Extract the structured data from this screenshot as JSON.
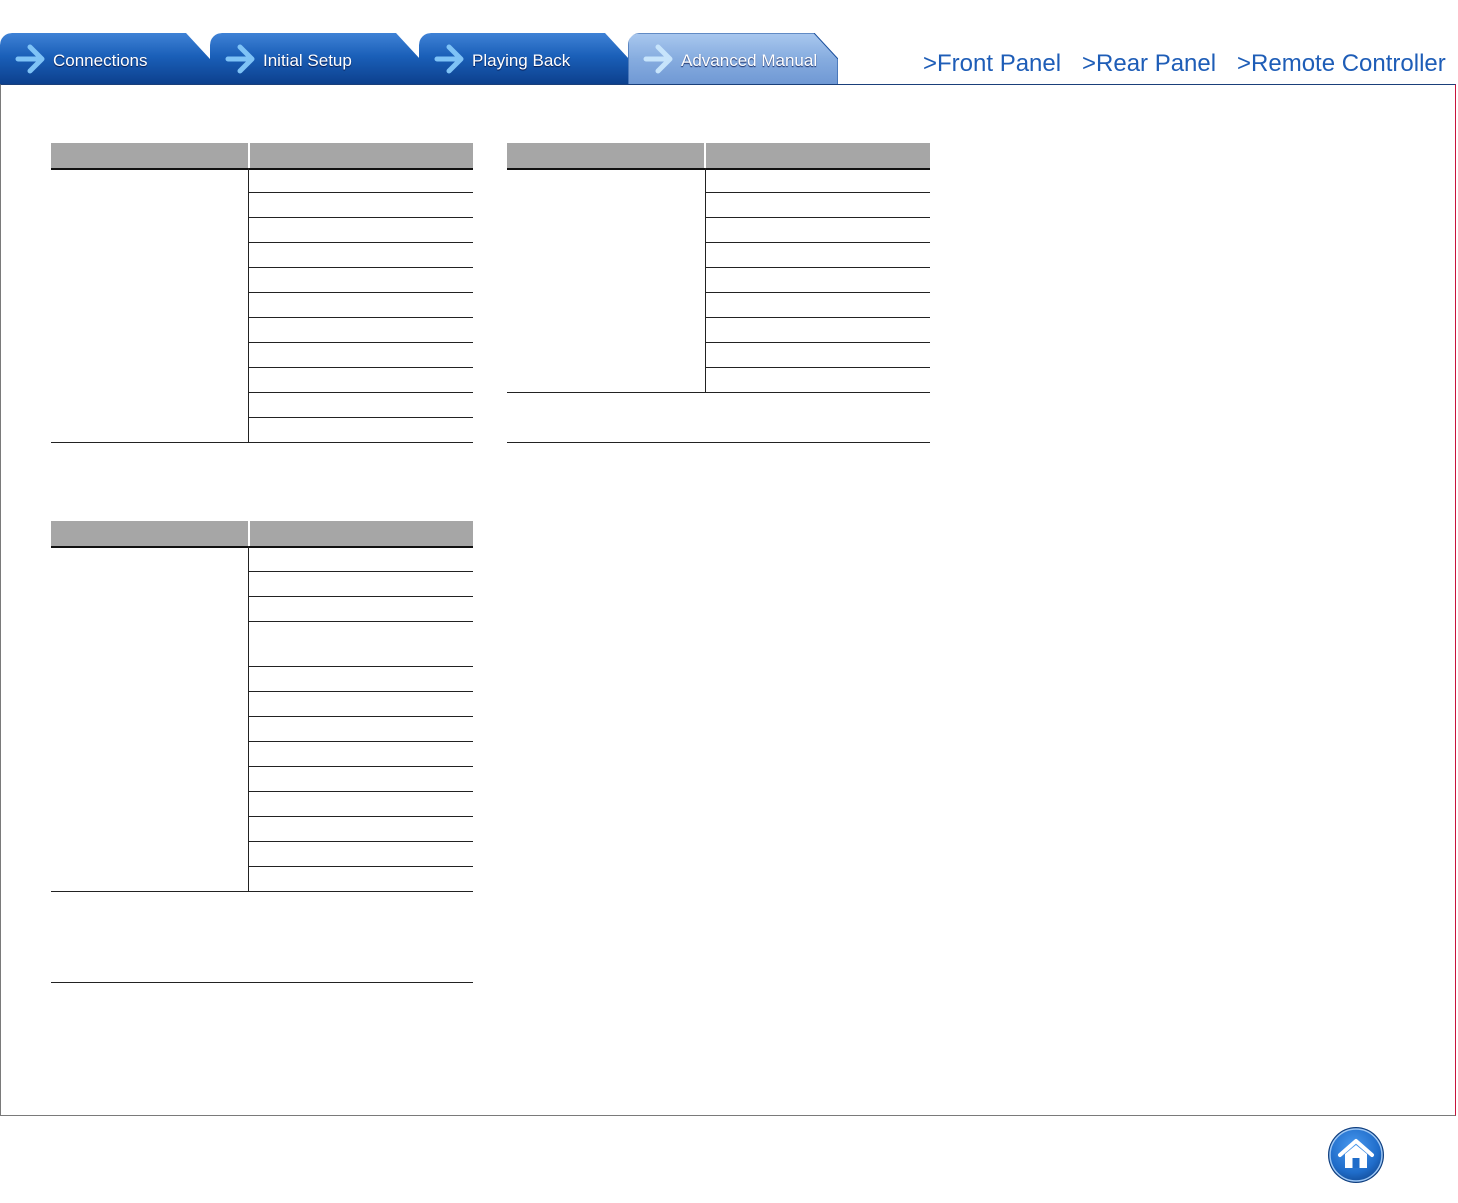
{
  "tabs": [
    {
      "label": "Connections",
      "active": false
    },
    {
      "label": "Initial Setup",
      "active": false
    },
    {
      "label": "Playing Back",
      "active": false
    },
    {
      "label": "Advanced Manual",
      "active": true
    }
  ],
  "nav": {
    "front_panel": ">Front Panel",
    "rear_panel": ">Rear Panel",
    "remote_controller": ">Remote Controller"
  },
  "colors": {
    "tab_active": "#8fb4e6",
    "tab_inactive": "#0f4fa5",
    "nav_link": "#1e5db7",
    "table_header": "#a6a6a6",
    "home_button": "#1f6cc9"
  },
  "home": {
    "icon": "home-icon"
  }
}
